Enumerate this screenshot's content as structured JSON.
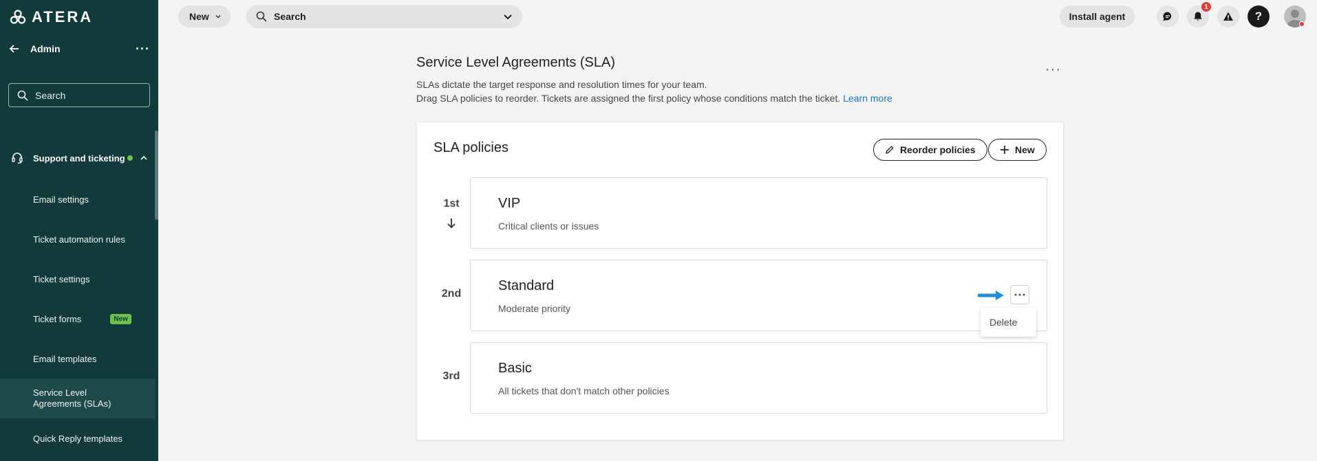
{
  "brand": {
    "name": "ATERA"
  },
  "sidebar": {
    "admin_label": "Admin",
    "search_placeholder": "Search",
    "group_label": "Support and ticketing",
    "items": [
      {
        "label": "Email settings"
      },
      {
        "label": "Ticket automation rules"
      },
      {
        "label": "Ticket settings"
      },
      {
        "label": "Ticket forms",
        "badge": "New"
      },
      {
        "label": "Email templates"
      },
      {
        "label": "Service Level Agreements (SLAs)",
        "active": true
      },
      {
        "label": "Quick Reply templates"
      }
    ]
  },
  "topbar": {
    "new_label": "New",
    "search_label": "Search",
    "install_agent_label": "Install agent",
    "notification_count": "1",
    "help_label": "?"
  },
  "page": {
    "title": "Service Level Agreements (SLA)",
    "desc_line1": "SLAs dictate the target response and resolution times for your team.",
    "desc_line2": "Drag SLA policies to reorder. Tickets are assigned the first policy whose conditions match the ticket.",
    "learn_more": "Learn more"
  },
  "policies_card": {
    "title": "SLA policies",
    "reorder_label": "Reorder policies",
    "new_label": "New",
    "policies": [
      {
        "rank": "1st",
        "name": "VIP",
        "description": "Critical clients or issues"
      },
      {
        "rank": "2nd",
        "name": "Standard",
        "description": "Moderate priority"
      },
      {
        "rank": "3rd",
        "name": "Basic",
        "description": "All tickets that don't match other policies"
      }
    ],
    "context_menu": {
      "delete_label": "Delete"
    }
  },
  "colors": {
    "sidebar_bg": "#123a3a",
    "accent_green": "#6cc24a",
    "link_blue": "#1a73c9",
    "arrow_blue": "#1f8fd6"
  }
}
